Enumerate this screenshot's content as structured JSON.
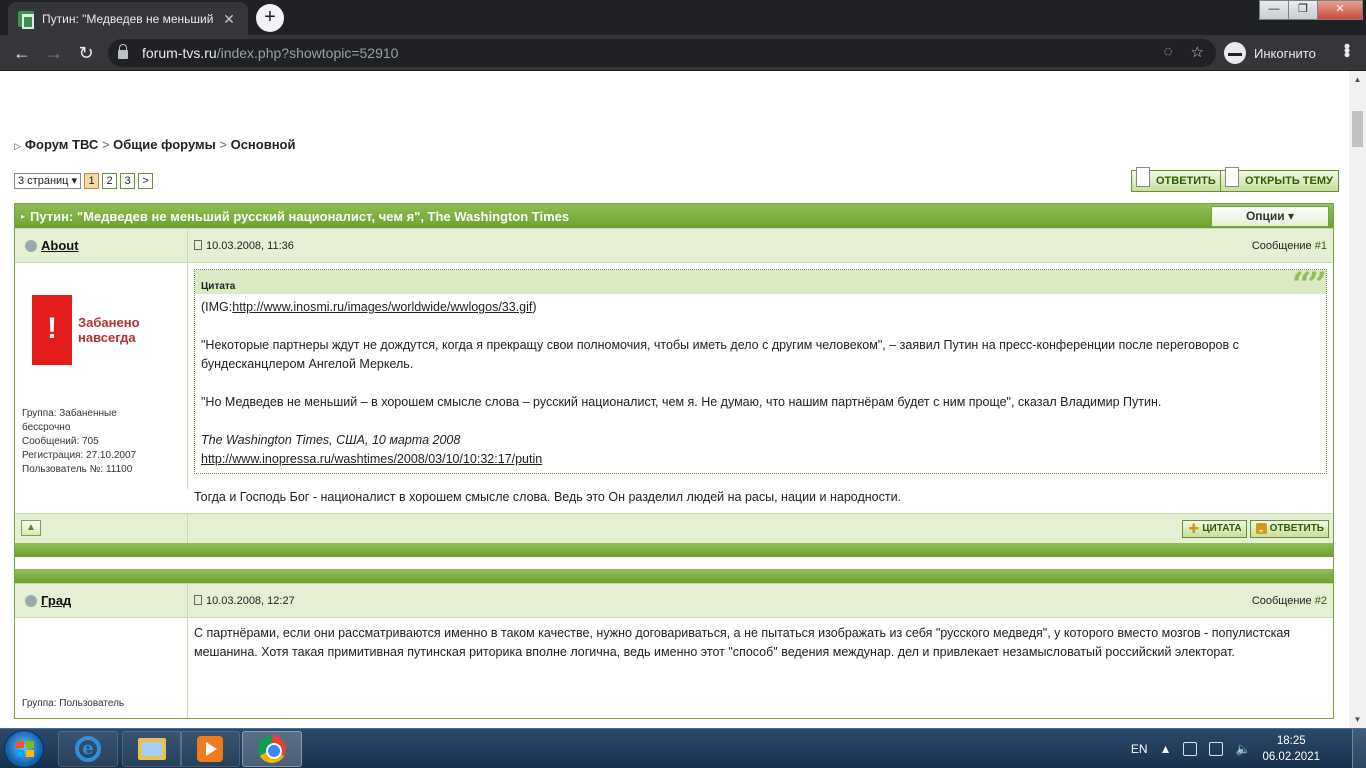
{
  "browser": {
    "tab_title": "Путин: \"Медведев не меньший",
    "url_host": "forum-tvs.ru",
    "url_path": "/index.php?showtopic=52910",
    "incognito_label": "Инкогнито"
  },
  "forum": {
    "breadcrumb": [
      "Форум ТВС",
      "Общие форумы",
      "Основной"
    ],
    "breadcrumb_sep": ">",
    "pages_dropdown": "3 страниц",
    "pages": [
      "1",
      "2",
      "3",
      ">"
    ],
    "current_page": "1",
    "reply_btn": "Ответить",
    "new_topic_btn": "Открыть тему",
    "topic_title": "Путин: \"Медведев не меньший русский националист, чем я\", The Washington Times",
    "options_btn": "Опции ▾"
  },
  "posts": [
    {
      "author": "About",
      "date": "10.03.2008, 11:36",
      "msg_label": "Сообщение",
      "msg_no": "#1",
      "ban_mark": "!",
      "ban_line1": "Забанено",
      "ban_line2": "навсегда",
      "info": [
        "Группа: Забаненные",
        "бессрочно",
        "Сообщений: 705",
        "Регистрация: 27.10.2007",
        "Пользователь №: 11100"
      ],
      "quote_label": "Цитата",
      "quote_p1_prefix": "(IMG:",
      "quote_p1_link": "http://www.inosmi.ru/images/worldwide/wwlogos/33.gif",
      "quote_p1_suffix": ")",
      "quote_p2": "\"Некоторые партнеры ждут не дождутся, когда я прекращу свои полномочия, чтобы иметь дело с другим человеком\", – заявил Путин на пресс-конференции после переговоров с бундесканцлером Ангелой Меркель.",
      "quote_p3": "\"Но Медведев не меньший – в хорошем смысле слова – русский националист, чем я. Не думаю, что нашим партнёрам будет с ним проще\", сказал Владимир Путин.",
      "quote_source": "The Washington Times, США, 10 марта 2008",
      "quote_link": "http://www.inopressa.ru/washtimes/2008/03/10/10:32:17/putin",
      "text": "Тогда и Господь Бог - националист в хорошем смысле слова. Ведь это Он разделил людей на расы, нации и народности.",
      "quote_btn": "Цитата",
      "reply_btn": "Ответить"
    },
    {
      "author": "Град",
      "date": "10.03.2008, 12:27",
      "msg_label": "Сообщение",
      "msg_no": "#2",
      "info": [
        "Группа: Пользователь"
      ],
      "text": "С партнёрами, если они рассматриваются именно в таком качестве, нужно договариваться, а не пытаться изображать из себя \"русского медведя\", у которого вместо мозгов - популистская мешанина. Хотя такая примитивная путинская риторика вполне логична, ведь именно этот \"способ\" ведения междунар. дел и привлекает незамысловатый российский электорат."
    }
  ],
  "taskbar": {
    "lang": "EN",
    "time": "18:25",
    "date": "06.02.2021"
  }
}
